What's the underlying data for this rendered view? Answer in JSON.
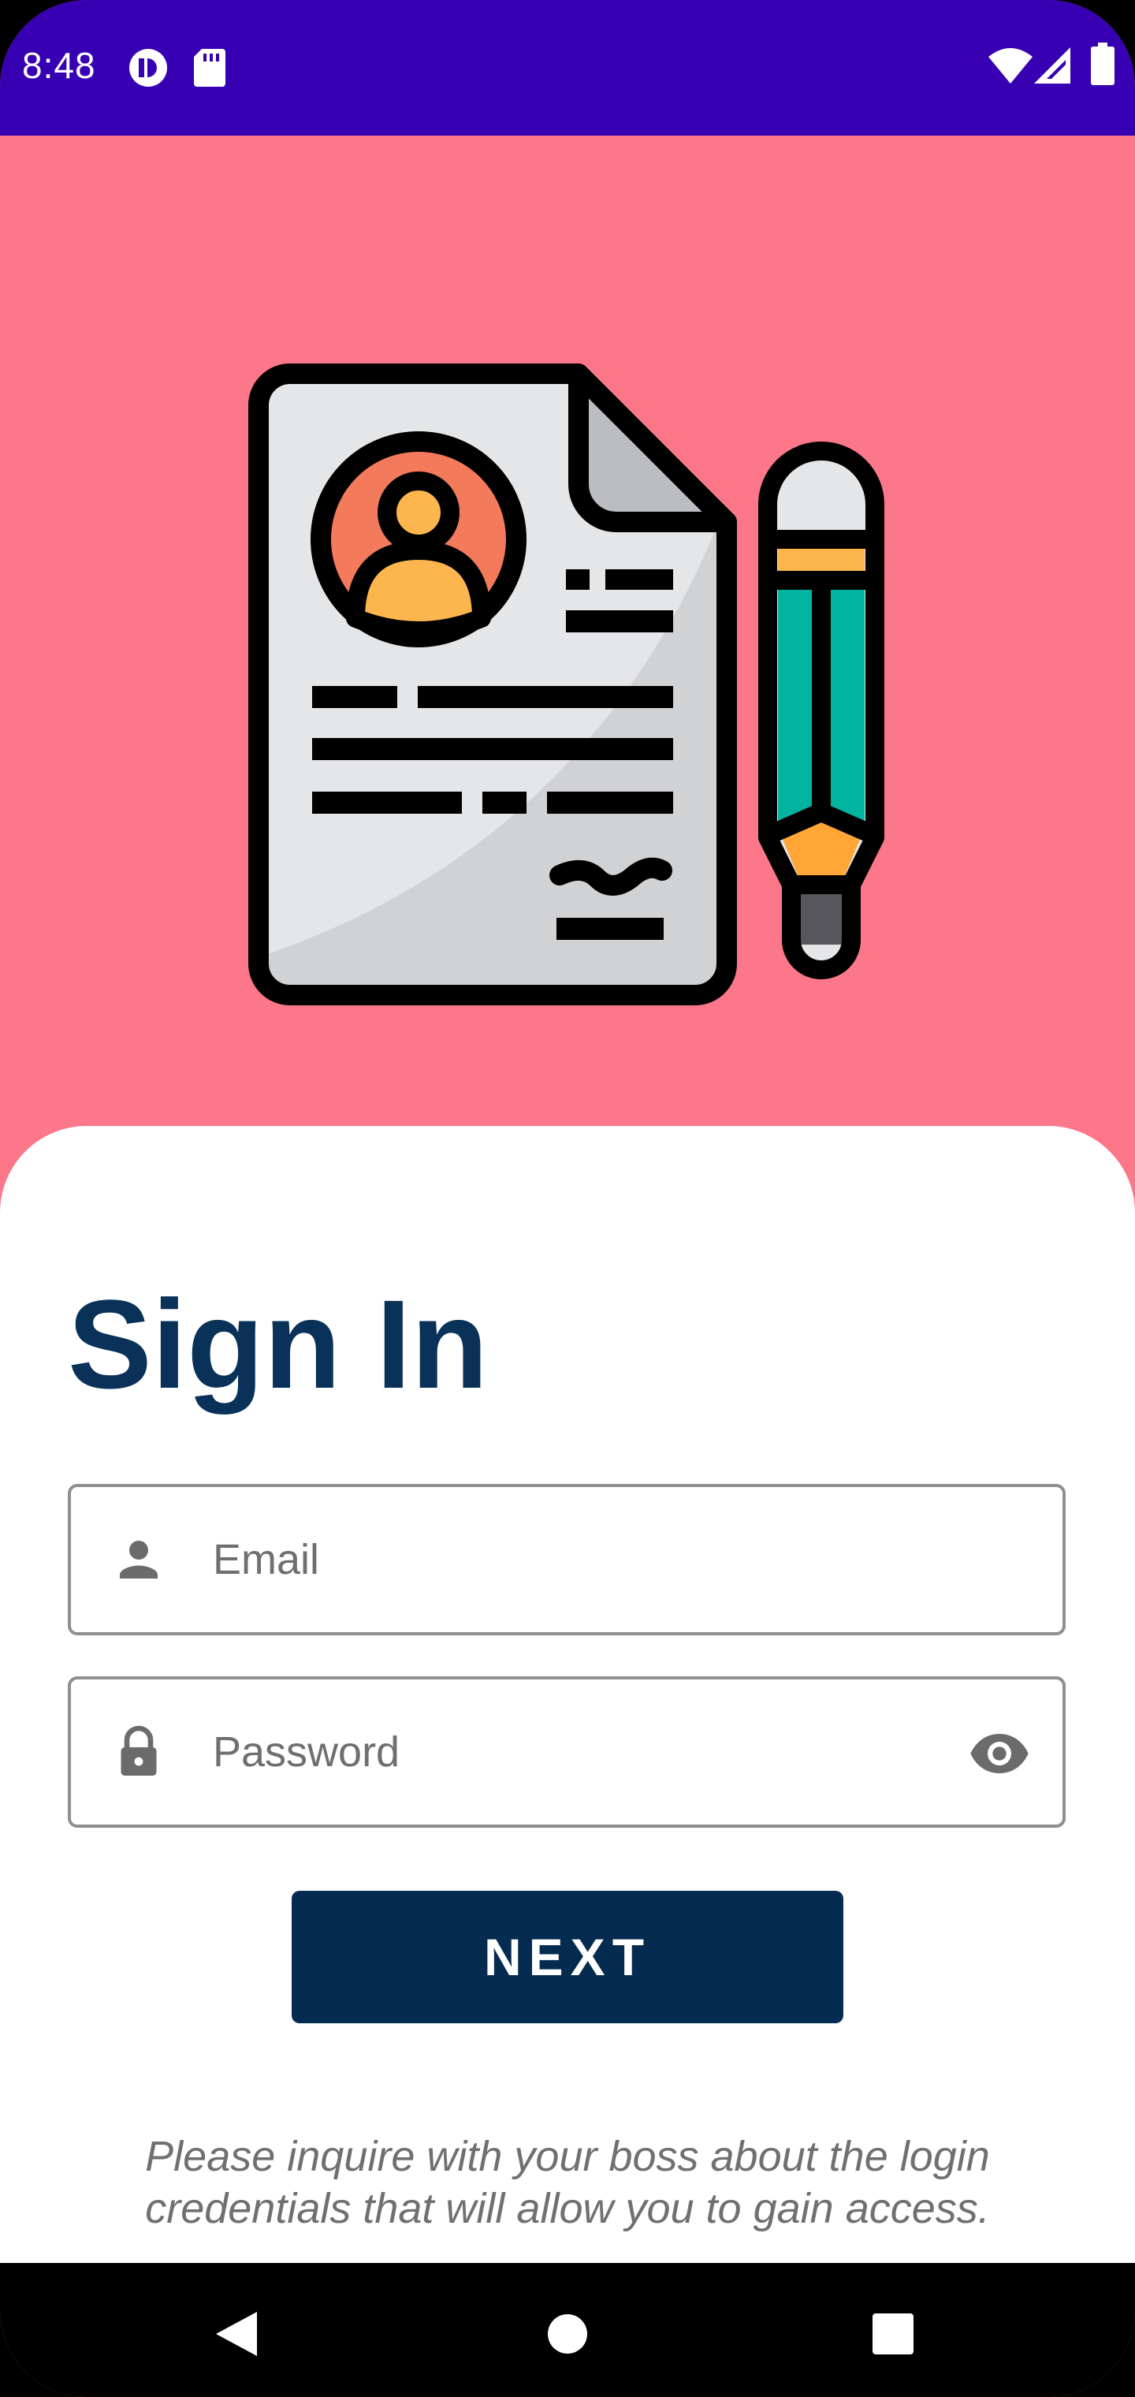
{
  "status_bar": {
    "time": "8:48",
    "left_icons": [
      "app-notification-icon",
      "sd-card-icon"
    ],
    "right_icons": [
      "wifi-icon",
      "cell-signal-icon",
      "battery-icon"
    ],
    "background": "#3700b3"
  },
  "hero": {
    "illustration": "resume-document-with-pencil",
    "background": "#fb7789"
  },
  "form": {
    "title": "Sign In",
    "email": {
      "placeholder": "Email",
      "value": "",
      "icon": "person-icon"
    },
    "password": {
      "placeholder": "Password",
      "value": "",
      "icon": "lock-icon",
      "toggle_icon": "eye-icon"
    },
    "next_label": "NEXT",
    "hint": "Please inquire with your boss about the login credentials that will allow you to gain access."
  },
  "nav_bar": {
    "buttons": [
      "back-icon",
      "home-icon",
      "recents-icon"
    ]
  },
  "colors": {
    "accent": "#062b51",
    "title": "#0a3258",
    "hero": "#fb7789",
    "status_bar": "#3700b3"
  }
}
